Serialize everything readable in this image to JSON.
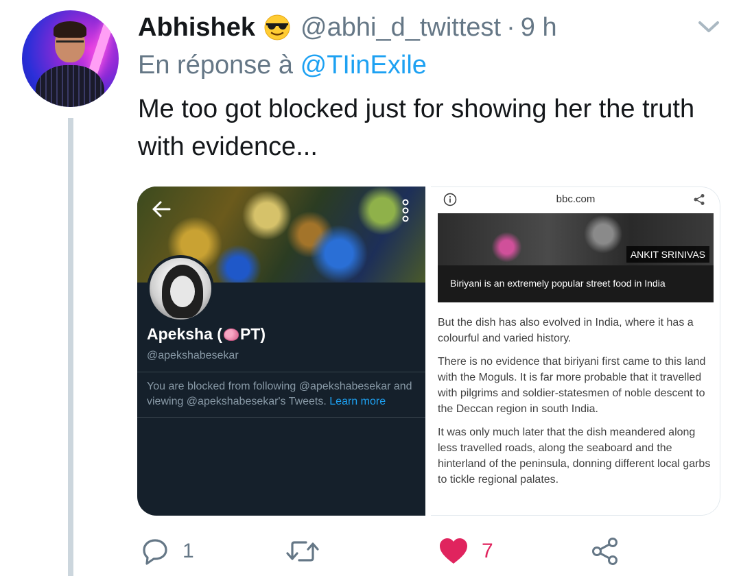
{
  "tweet": {
    "author_name": "Abhishek",
    "author_emoji": "sunglasses-emoji",
    "handle": "@abhi_d_twittest",
    "separator": "·",
    "time": "9 h",
    "reply_prefix": "En réponse à",
    "reply_to": "@TIinExile",
    "text": "Me too got blocked just for showing her the truth with evidence..."
  },
  "media_left": {
    "profile_name_before": "Apeksha (",
    "profile_name_after": "PT)",
    "profile_handle": "@apekshabesekar",
    "blocked_text": "You are blocked from following @apekshabesekar and viewing @apekshabesekar's Tweets.",
    "learn_more": "Learn more"
  },
  "media_right": {
    "domain": "bbc.com",
    "photo_credit": "ANKIT SRINIVAS",
    "caption": "Biriyani is an extremely popular street food in India",
    "paragraphs": [
      "But the dish has also evolved in India, where it has a colourful and varied history.",
      "There is no evidence that biriyani first came to this land with the Moguls. It is far more probable that it travelled with pilgrims and soldier-statesmen of noble descent to the Deccan region in south India.",
      "It was only much later that the dish meandered along less travelled roads, along the seaboard and the hinterland of the peninsula, donning different local garbs to tickle regional palates."
    ]
  },
  "actions": {
    "reply_count": "1",
    "retweet_count": "",
    "like_count": "7"
  },
  "colors": {
    "accent": "#1da1f2",
    "like": "#e0245e",
    "muted": "#657786",
    "text": "#14171a"
  }
}
